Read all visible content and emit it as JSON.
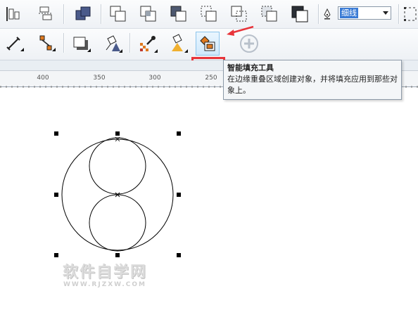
{
  "toolbar": {
    "outline_width_value": "细线",
    "icons_row1": [
      "align-icon",
      "distribute-icon",
      "weld-icon",
      "trim-icon",
      "intersect-icon",
      "simplify-icon",
      "front-minus-back-icon",
      "back-minus-front-icon",
      "create-boundary-icon",
      "pen-icon"
    ],
    "icons_row2": [
      "dimension-tool-icon",
      "connector-tool-icon",
      "drop-shadow-tool-icon",
      "transparency-tool-icon",
      "color-eyedropper-icon",
      "interactive-fill-icon",
      "smart-fill-icon",
      "add-icon"
    ],
    "active_tool": "smart-fill-icon"
  },
  "ruler": {
    "labels": [
      "400",
      "350",
      "300",
      "250"
    ]
  },
  "tooltip": {
    "title": "智能填充工具",
    "description": "在边缘重叠区域创建对象，并将填充应用到那些对象上。"
  },
  "watermark": {
    "main": "软件自学网",
    "sub": "WWW.RJZXW.COM"
  },
  "colors": {
    "highlight_border": "#e8343a",
    "selection_bg": "#3a7bd5",
    "accent_orange": "#e07a1f"
  }
}
